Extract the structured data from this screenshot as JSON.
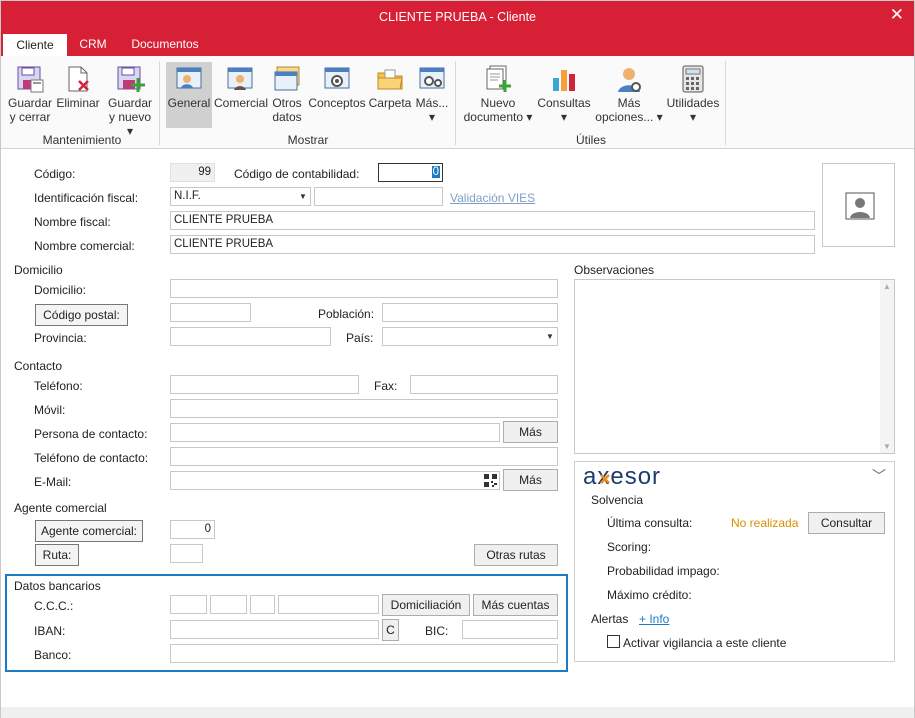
{
  "window": {
    "title": "CLIENTE PRUEBA - Cliente",
    "close": "✕"
  },
  "tabs": [
    "Cliente",
    "CRM",
    "Documentos"
  ],
  "ribbon": {
    "buttons": [
      {
        "l1": "Guardar",
        "l2": "y cerrar",
        "icon": "save-close-icon"
      },
      {
        "l1": "Eliminar",
        "l2": "",
        "icon": "delete-icon"
      },
      {
        "l1": "Guardar",
        "l2": "y nuevo ▾",
        "icon": "save-new-icon"
      },
      {
        "l1": "General",
        "l2": "",
        "icon": "general-card-icon"
      },
      {
        "l1": "Comercial",
        "l2": "",
        "icon": "commercial-icon"
      },
      {
        "l1": "Otros",
        "l2": "datos",
        "icon": "other-data-icon"
      },
      {
        "l1": "Conceptos",
        "l2": "",
        "icon": "concepts-icon"
      },
      {
        "l1": "Carpeta",
        "l2": "",
        "icon": "folder-icon"
      },
      {
        "l1": "Más...",
        "l2": "▾",
        "icon": "more-icon"
      },
      {
        "l1": "Nuevo",
        "l2": "documento ▾",
        "icon": "new-document-icon"
      },
      {
        "l1": "Consultas",
        "l2": "▾",
        "icon": "chart-icon"
      },
      {
        "l1": "Más",
        "l2": "opciones... ▾",
        "icon": "more-options-icon"
      },
      {
        "l1": "Utilidades",
        "l2": "▾",
        "icon": "calculator-icon"
      }
    ],
    "groups": [
      "Mantenimiento",
      "Mostrar",
      "Útiles"
    ]
  },
  "form": {
    "codigo_label": "Código:",
    "codigo": "99",
    "contab_label": "Código de contabilidad:",
    "contab": "0",
    "idfiscal_label": "Identificación fiscal:",
    "idfiscal": "N.I.F.",
    "vies": "Validación VIES",
    "nombre_fiscal_label": "Nombre fiscal:",
    "nombre_fiscal": "CLIENTE PRUEBA",
    "nombre_comercial_label": "Nombre comercial:",
    "nombre_comercial": "CLIENTE PRUEBA",
    "domicilio_section": "Domicilio",
    "domicilio_label": "Domicilio:",
    "cp_button": "Código postal:",
    "poblacion_label": "Población:",
    "provincia_label": "Provincia:",
    "pais_label": "País:",
    "contacto_section": "Contacto",
    "telefono_label": "Teléfono:",
    "fax_label": "Fax:",
    "movil_label": "Móvil:",
    "persona_label": "Persona de contacto:",
    "mas": "Más",
    "tel_contacto_label": "Teléfono de contacto:",
    "email_label": "E-Mail:",
    "agente_section": "Agente comercial",
    "agente_button": "Agente comercial:",
    "agente": "0",
    "ruta_button": "Ruta:",
    "otras_rutas": "Otras rutas",
    "bancarios_section": "Datos bancarios",
    "ccc_label": "C.C.C.:",
    "domiciliacion": "Domiciliación",
    "mas_cuentas": "Más cuentas",
    "iban_label": "IBAN:",
    "iban_c": "C",
    "bic_label": "BIC:",
    "banco_label": "Banco:",
    "observaciones": "Observaciones"
  },
  "axesor": {
    "logo": "axesor",
    "solvencia": "Solvencia",
    "ultima_label": "Última consulta:",
    "ultima": "No realizada",
    "consultar": "Consultar",
    "scoring": "Scoring:",
    "probabilidad": "Probabilidad impago:",
    "maximo": "Máximo crédito:",
    "alertas": "Alertas",
    "info": "+ Info",
    "vigilancia": "Activar vigilancia a este cliente"
  },
  "colors": {
    "titlebar": "#d71f36",
    "highlight": "#1b7cc4",
    "warning": "#d99000"
  }
}
